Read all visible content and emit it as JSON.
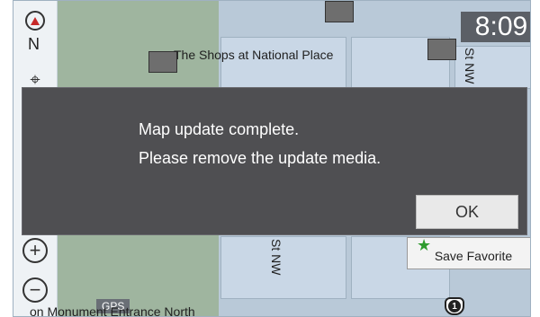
{
  "map": {
    "labels": {
      "shops": "The Shops at National Place",
      "street_top_right": "St NW",
      "street_bottom": "St NW",
      "bottom_left": "on Monument Entrance North"
    },
    "gps_label": "GPS",
    "route_shield_number": "1"
  },
  "toolbar": {
    "compass_heading": "N",
    "zoom_in_label": "+",
    "zoom_out_label": "−"
  },
  "status": {
    "time": "8:09"
  },
  "favorite": {
    "label": "Save Favorite"
  },
  "dialog": {
    "line1": "Map update complete.",
    "line2": "Please remove the update media.",
    "ok_label": "OK"
  },
  "colors": {
    "dialog_background": "#4f4f52",
    "ok_button": "#e9e9e9",
    "clock_background": "#5b5f66",
    "map_background": "#b9c9d8",
    "park": "#9fb59f",
    "favorite_star": "#2e9b2e"
  }
}
